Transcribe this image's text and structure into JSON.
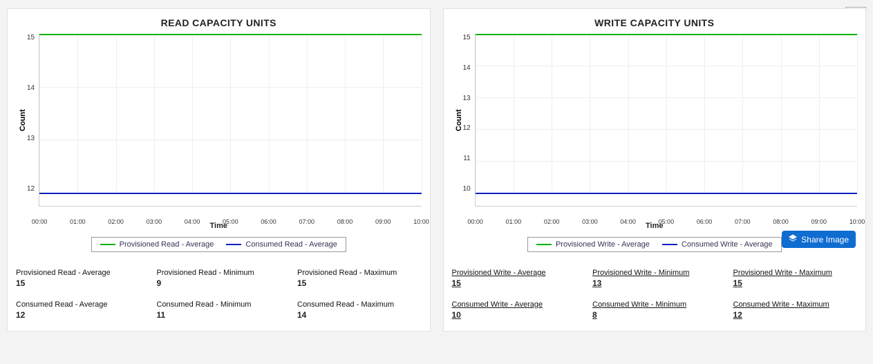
{
  "share_button_label": "Share Image",
  "panels": [
    {
      "title": "READ CAPACITY UNITS",
      "ylabel": "Count",
      "xlabel": "Time",
      "underlined_stats": false,
      "y_ticks": [
        "15",
        "14",
        "13",
        "12"
      ],
      "x_ticks": [
        "00:00",
        "01:00",
        "02:00",
        "03:00",
        "04:00",
        "05:00",
        "06:00",
        "07:00",
        "08:00",
        "09:00",
        "10:00"
      ],
      "legend": [
        {
          "label": "Provisioned Read - Average",
          "color": "#0db300"
        },
        {
          "label": "Consumed Read - Average",
          "color": "#0a1fbf"
        }
      ],
      "stats": [
        {
          "label": "Provisioned Read - Average",
          "value": "15"
        },
        {
          "label": "Provisioned Read - Minimum",
          "value": "9"
        },
        {
          "label": "Provisioned Read - Maximum",
          "value": "15"
        },
        {
          "label": "Consumed Read - Average",
          "value": "12"
        },
        {
          "label": "Consumed Read - Minimum",
          "value": "11"
        },
        {
          "label": "Consumed Read - Maximum",
          "value": "14"
        }
      ]
    },
    {
      "title": "WRITE CAPACITY UNITS",
      "ylabel": "Count",
      "xlabel": "Time",
      "underlined_stats": true,
      "y_ticks": [
        "15",
        "14",
        "13",
        "12",
        "11",
        "10"
      ],
      "x_ticks": [
        "00:00",
        "01:00",
        "02:00",
        "03:00",
        "04:00",
        "05:00",
        "06:00",
        "07:00",
        "08:00",
        "09:00",
        "10:00"
      ],
      "legend": [
        {
          "label": "Provisioned Write - Average",
          "color": "#0db300"
        },
        {
          "label": "Consumed Write - Average",
          "color": "#0a1fbf"
        }
      ],
      "stats": [
        {
          "label": "Provisioned Write - Average",
          "value": "15"
        },
        {
          "label": "Provisioned Write - Minimum",
          "value": "13"
        },
        {
          "label": "Provisioned Write - Maximum",
          "value": "15"
        },
        {
          "label": "Consumed Write - Average",
          "value": "10"
        },
        {
          "label": "Consumed Write - Minimum",
          "value": "8"
        },
        {
          "label": "Consumed Write - Maximum",
          "value": "12"
        }
      ]
    }
  ],
  "chart_data": [
    {
      "type": "line",
      "title": "READ CAPACITY UNITS",
      "xlabel": "Time",
      "ylabel": "Count",
      "ylim": [
        12,
        15
      ],
      "x": [
        "00:00",
        "01:00",
        "02:00",
        "03:00",
        "04:00",
        "05:00",
        "06:00",
        "07:00",
        "08:00",
        "09:00",
        "10:00"
      ],
      "series": [
        {
          "name": "Provisioned Read - Average",
          "color": "#0db300",
          "values": [
            15,
            15,
            15,
            15,
            15,
            15,
            15,
            15,
            15,
            15,
            15
          ]
        },
        {
          "name": "Consumed Read - Average",
          "color": "#0a1fbf",
          "values": [
            12,
            12,
            12,
            12,
            12,
            12,
            12,
            12,
            12,
            12,
            12
          ]
        }
      ],
      "legend_position": "bottom",
      "grid": true
    },
    {
      "type": "line",
      "title": "WRITE CAPACITY UNITS",
      "xlabel": "Time",
      "ylabel": "Count",
      "ylim": [
        10,
        15
      ],
      "x": [
        "00:00",
        "01:00",
        "02:00",
        "03:00",
        "04:00",
        "05:00",
        "06:00",
        "07:00",
        "08:00",
        "09:00",
        "10:00"
      ],
      "series": [
        {
          "name": "Provisioned Write - Average",
          "color": "#0db300",
          "values": [
            15,
            15,
            15,
            15,
            15,
            15,
            15,
            15,
            15,
            15,
            15
          ]
        },
        {
          "name": "Consumed Write - Average",
          "color": "#0a1fbf",
          "values": [
            10,
            10,
            10,
            10,
            10,
            10,
            10,
            10,
            10,
            10,
            10
          ]
        }
      ],
      "legend_position": "bottom",
      "grid": true
    }
  ]
}
